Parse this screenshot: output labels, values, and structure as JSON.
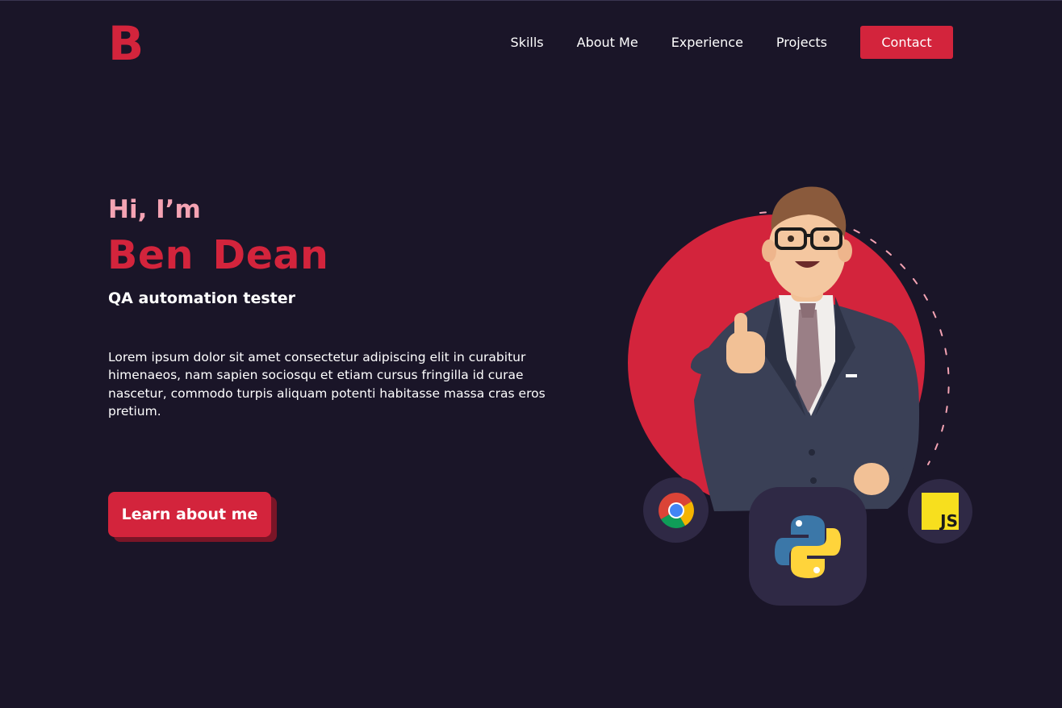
{
  "header": {
    "logo": "B",
    "nav": [
      {
        "label": "Skills"
      },
      {
        "label": "About Me"
      },
      {
        "label": "Experience"
      },
      {
        "label": "Projects"
      }
    ],
    "contact_label": "Contact"
  },
  "hero": {
    "greeting": "Hi, I’m",
    "name": "Ben Dean",
    "role": "QA automation tester",
    "description": "Lorem ipsum dolor sit amet consectetur adipiscing elit in curabitur himenaeos, nam sapien sociosqu et etiam cursus fringilla id curae nascetur, commodo turpis aliquam potenti habitasse massa cras eros pretium.",
    "cta_label": "Learn about me"
  },
  "illustration": {
    "tech_icons": [
      "chrome-icon",
      "python-icon",
      "javascript-icon"
    ],
    "js_badge": "JS"
  },
  "colors": {
    "background": "#1a1528",
    "accent": "#d3243c",
    "accent_light": "#f4a3b3",
    "bubble": "#2f2945"
  }
}
